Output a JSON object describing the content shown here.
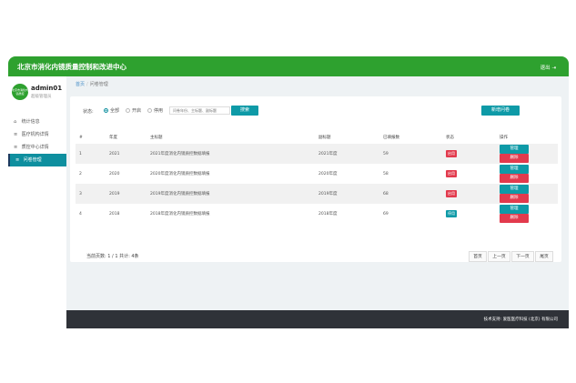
{
  "header": {
    "title": "北京市消化内镜质量控制和改进中心",
    "logout_label": "退出",
    "logout_icon": "exit-arrow-icon"
  },
  "user": {
    "avatar_text": "北京市消化内镜质控",
    "name": "admin01",
    "role": "超级管理员"
  },
  "sidebar": {
    "items": [
      {
        "label": "统计信息",
        "icon": "home-icon",
        "glyph": "⌂"
      },
      {
        "label": "医疗机构详情",
        "icon": "list-icon",
        "glyph": "≡"
      },
      {
        "label": "质控中心详情",
        "icon": "list-icon",
        "glyph": "≡"
      },
      {
        "label": "问卷管理",
        "icon": "list-icon",
        "glyph": "≡",
        "active": true
      }
    ]
  },
  "breadcrumb": {
    "home": "首页",
    "sep": "/",
    "current": "问卷管理"
  },
  "filter": {
    "label": "状态:",
    "options": [
      "全部",
      "开启",
      "停用"
    ],
    "selected": "全部",
    "search_placeholder": "问卷年份、主标题、副标题",
    "search_button": "搜索",
    "add_button": "新增问卷"
  },
  "table": {
    "headers": [
      "#",
      "年度",
      "主标题",
      "副标题",
      "已填报数",
      "状态",
      "操作"
    ],
    "rows": [
      {
        "idx": "1",
        "year": "2021",
        "title": "2021年度消化内镜质控数据填报",
        "subtitle": "2021年度",
        "count": "59",
        "status": "启用",
        "status_color": "#e23a4d",
        "manage": "管理",
        "delete": "删除"
      },
      {
        "idx": "2",
        "year": "2020",
        "title": "2020年度消化内镜质控数据填报",
        "subtitle": "2020年度",
        "count": "58",
        "status": "启用",
        "status_color": "#e23a4d",
        "manage": "管理",
        "delete": "删除"
      },
      {
        "idx": "3",
        "year": "2019",
        "title": "2019年度消化内镜质控数据填报",
        "subtitle": "2019年度",
        "count": "68",
        "status": "启用",
        "status_color": "#e23a4d",
        "manage": "管理",
        "delete": "删除"
      },
      {
        "idx": "4",
        "year": "2018",
        "title": "2018年度消化内镜质控数据填报",
        "subtitle": "2018年度",
        "count": "69",
        "status": "停用",
        "status_color": "#0e9aa7",
        "manage": "管理",
        "delete": "删除"
      }
    ]
  },
  "pagination": {
    "info": "当前页数: 1 / 1  共计: 4条",
    "first": "首页",
    "prev": "上一页",
    "next": "下一页",
    "last": "尾页"
  },
  "footer": {
    "text": "技术支持: 爱医医疗科技 (北京) 有限公司"
  },
  "colors": {
    "brand_green": "#2ea12f",
    "accent_teal": "#0e9aa7",
    "danger_red": "#e23a4d",
    "footer_dark": "#2f3238"
  }
}
